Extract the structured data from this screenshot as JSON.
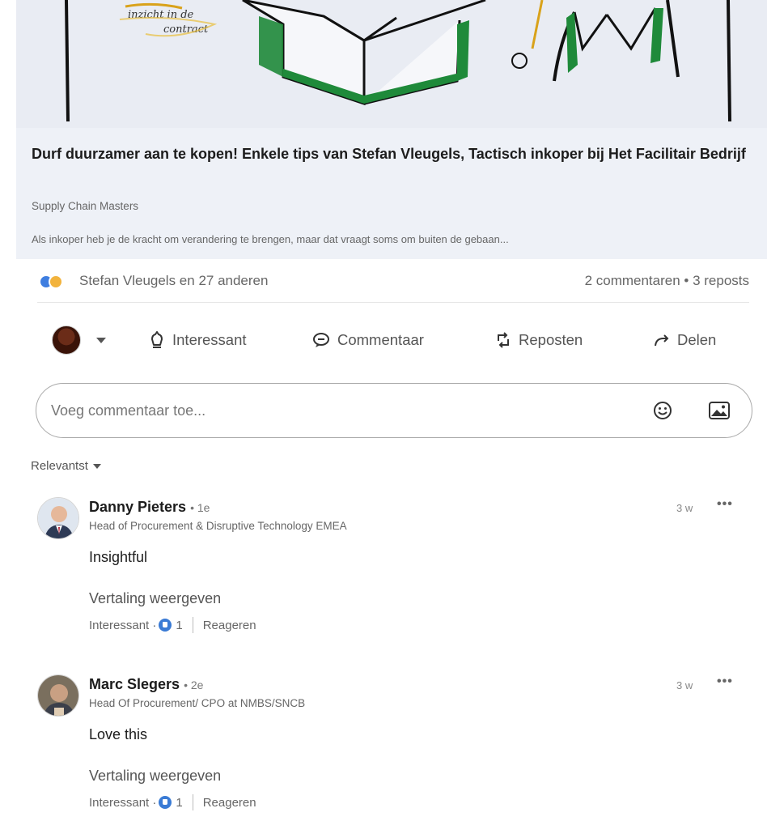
{
  "article": {
    "title": "Durf duurzamer aan te kopen! Enkele tips van Stefan Vleugels, Tactisch inkoper bij Het Facilitair Bedrijf",
    "source": "Supply Chain Masters",
    "snippet": "Als inkoper heb je de kracht om verandering te brengen, maar dat vraagt soms om buiten de gebaan..."
  },
  "social": {
    "reactors": "Stefan Vleugels en 27 anderen",
    "comments_reposts": "2 commentaren • 3 reposts"
  },
  "actions": {
    "interesting": "Interessant",
    "comment": "Commentaar",
    "repost": "Reposten",
    "share": "Delen"
  },
  "comment_input": {
    "placeholder": "Voeg commentaar toe..."
  },
  "sort": {
    "label": "Relevantst"
  },
  "comments": [
    {
      "name": "Danny Pieters",
      "degree": "• 1e",
      "headline": "Head of Procurement & Disruptive Technology EMEA",
      "time": "3 w",
      "more": "•••",
      "text": "Insightful",
      "translate": "Vertaling weergeven",
      "reaction_label": "Interessant ·",
      "reaction_count": "1",
      "reply": "Reageren"
    },
    {
      "name": "Marc Slegers",
      "degree": "• 2e",
      "headline": "Head Of Procurement/ CPO at NMBS/SNCB",
      "time": "3 w",
      "more": "•••",
      "text": "Love this",
      "translate": "Vertaling weergeven",
      "reaction_label": "Interessant ·",
      "reaction_count": "1",
      "reply": "Reageren"
    }
  ],
  "colors": {
    "accent_blue": "#3a7bd5",
    "gold": "#f2b33d",
    "sketch_green": "#1f8a3a"
  },
  "hero_sketch_text": [
    "...",
    "inzicht in de",
    "contract"
  ]
}
